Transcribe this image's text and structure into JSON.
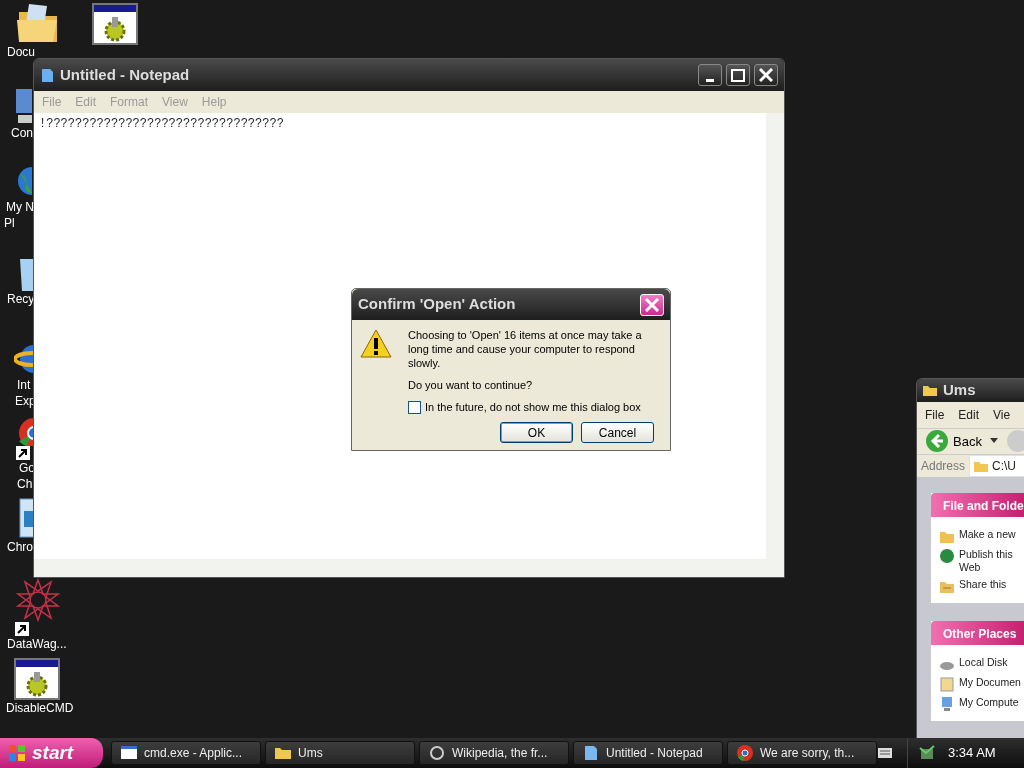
{
  "desktop_icons": [
    {
      "kind": "folder",
      "lines": [
        "Docu"
      ]
    },
    {
      "kind": "app"
    },
    {
      "kind": "computer",
      "lines": [
        "Con"
      ]
    },
    {
      "kind": "globe",
      "lines": [
        "My N",
        "Pl"
      ]
    },
    {
      "kind": "bin",
      "lines": [
        "Recy"
      ]
    },
    {
      "kind": "ie",
      "lines": [
        "Int",
        "Exp"
      ]
    },
    {
      "kind": "chrome",
      "lines": [
        "Go",
        "Ch"
      ],
      "shortcut": true
    },
    {
      "kind": "box",
      "lines": [
        "Chro"
      ]
    },
    {
      "kind": "star",
      "lines": [
        "DataWag..."
      ],
      "shortcut": true
    },
    {
      "kind": "app",
      "lines": [
        "DisableCMD"
      ]
    }
  ],
  "notepad": {
    "title": "Untitled - Notepad",
    "menu": [
      {
        "label": "File",
        "disabled": true
      },
      {
        "label": "Edit",
        "disabled": true
      },
      {
        "label": "Format",
        "disabled": true
      },
      {
        "label": "View",
        "disabled": true
      },
      {
        "label": "Help",
        "disabled": true
      }
    ],
    "text": "!?????????????????????????????????"
  },
  "dialog": {
    "title": "Confirm 'Open' Action",
    "message": "Choosing to 'Open' 16 items at once may take a long time and cause your computer to respond slowly.",
    "question": "Do you want to continue?",
    "checkbox": {
      "label": "In the future, do not show me this dialog box",
      "checked": false
    },
    "buttons": [
      {
        "label": "OK",
        "default": true
      },
      {
        "label": "Cancel",
        "default": false
      }
    ]
  },
  "explorer": {
    "title": "Ums",
    "menu": [
      "File",
      "Edit",
      "Vie"
    ],
    "back": "Back",
    "address_label": "Address",
    "address": "C:\\U",
    "panels": [
      {
        "title": "File and Folde",
        "items": [
          {
            "kind": "newfolder",
            "lines": [
              "Make a new"
            ]
          },
          {
            "kind": "web",
            "lines": [
              "Publish this",
              "Web"
            ]
          },
          {
            "kind": "share",
            "lines": [
              "Share this"
            ]
          }
        ]
      },
      {
        "title": "Other Places",
        "items": [
          {
            "kind": "disk",
            "lines": [
              "Local Disk"
            ]
          },
          {
            "kind": "docs",
            "lines": [
              "My Documen"
            ]
          },
          {
            "kind": "computer",
            "lines": [
              "My Compute"
            ]
          }
        ]
      }
    ]
  },
  "taskbar": {
    "start": "start",
    "items": [
      {
        "kind": "cmd",
        "label": "cmd.exe - Applic..."
      },
      {
        "kind": "folder",
        "label": "Ums"
      },
      {
        "kind": "wiki",
        "label": "Wikipedia, the fr..."
      },
      {
        "kind": "notepad",
        "label": "Untitled - Notepad"
      },
      {
        "kind": "chrome",
        "label": "We are sorry, th..."
      }
    ],
    "clock": "3:34 AM"
  }
}
